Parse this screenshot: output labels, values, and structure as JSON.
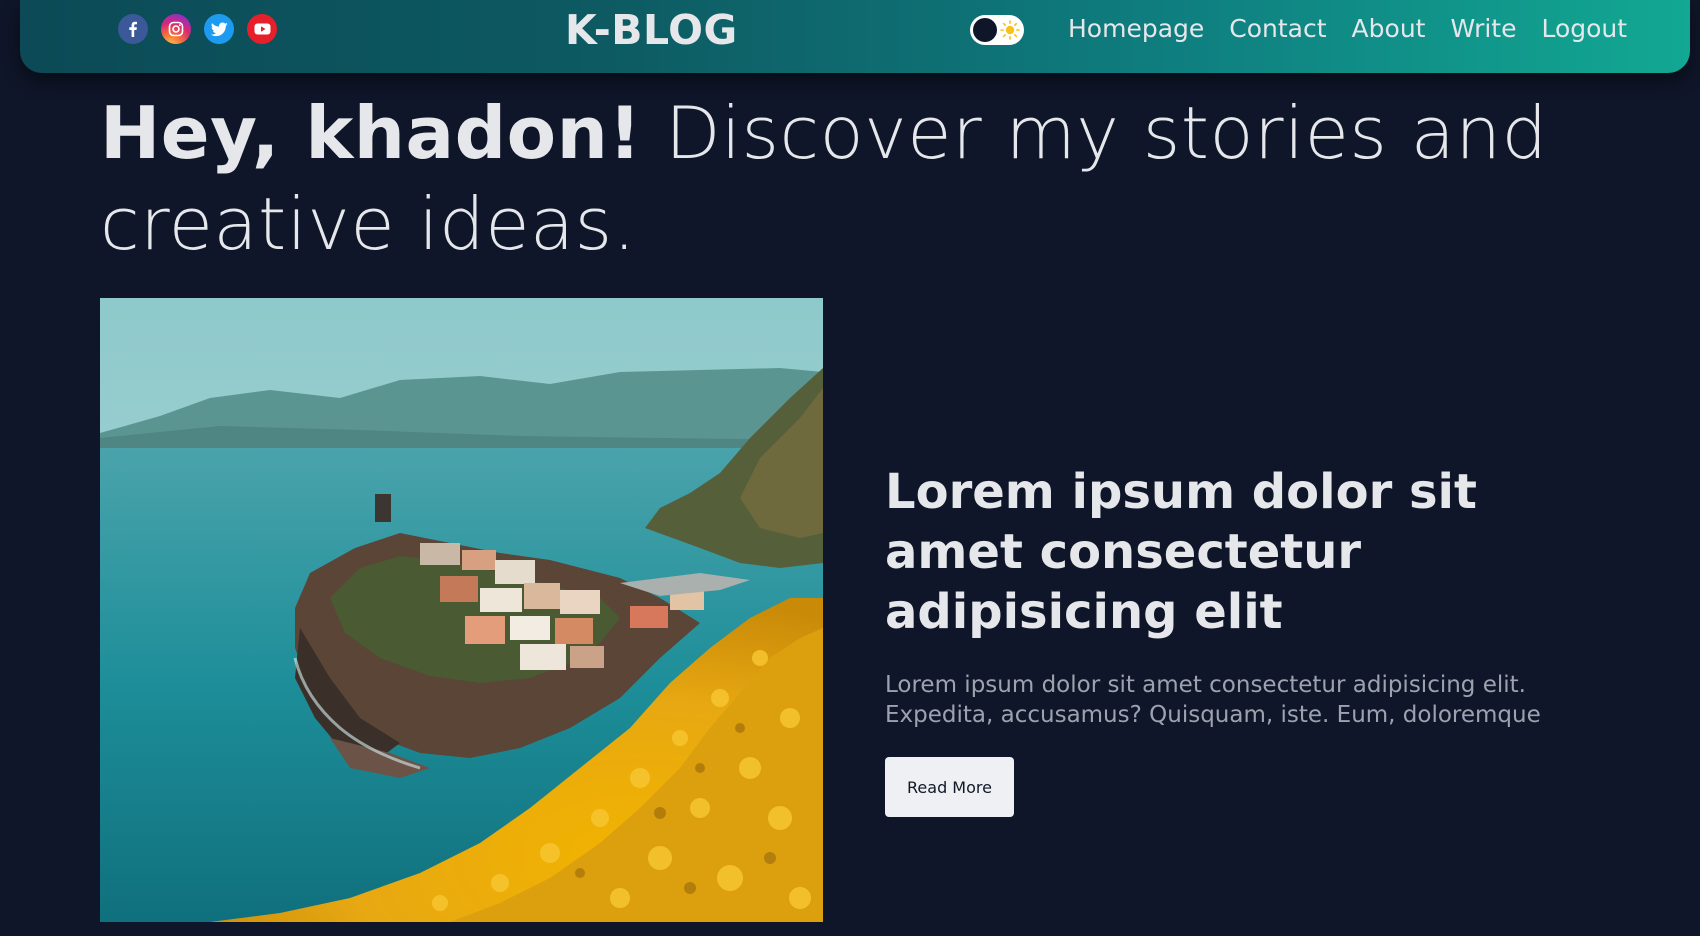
{
  "header": {
    "brand": "K-BLOG",
    "socials": [
      {
        "icon": "facebook-icon",
        "color": "#3b5998"
      },
      {
        "icon": "instagram-icon",
        "color": "#d62976"
      },
      {
        "icon": "twitter-icon",
        "color": "#1d9bf0"
      },
      {
        "icon": "youtube-icon",
        "color": "#e6202a"
      }
    ],
    "theme_toggle": {
      "icon": "sun-icon",
      "state": "dark"
    },
    "nav": {
      "homepage": "Homepage",
      "contact": "Contact",
      "about": "About",
      "write": "Write",
      "logout": "Logout"
    }
  },
  "hero": {
    "greeting_name": "Hey, khadon!",
    "tagline": " Discover my stories and creative ideas."
  },
  "post": {
    "title": "Lorem ipsum dolor sit amet consectetur adipisicing elit",
    "description": "Lorem ipsum dolor sit amet consectetur adipisicing elit. Expedita, accusamus? Quisquam, iste. Eum, doloremque",
    "read_more": "Read More",
    "image": "coastal-village-photo"
  },
  "colors": {
    "background": "#0f1629",
    "header_gradient_start": "#0b4a56",
    "header_gradient_end": "#12a893",
    "text_primary": "#e5e7eb",
    "text_secondary": "#9ca3af"
  }
}
